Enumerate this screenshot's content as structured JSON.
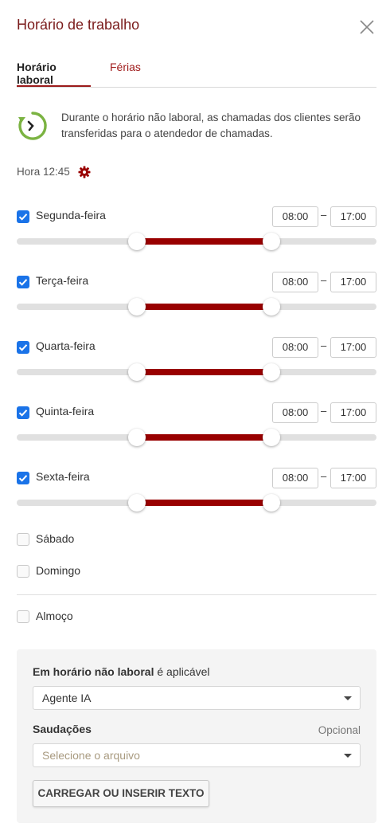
{
  "header": {
    "title": "Horário de trabalho"
  },
  "tabs": [
    {
      "label": "Horário laboral",
      "active": true
    },
    {
      "label": "Férias",
      "active": false
    }
  ],
  "info": {
    "text": "Durante o horário não laboral, as chamadas dos clientes serão transferidas para o atendedor de chamadas."
  },
  "clock": {
    "label": "Hora 12:45"
  },
  "days": [
    {
      "label": "Segunda-feira",
      "checked": true,
      "start": "08:00",
      "end": "17:00"
    },
    {
      "label": "Terça-feira",
      "checked": true,
      "start": "08:00",
      "end": "17:00"
    },
    {
      "label": "Quarta-feira",
      "checked": true,
      "start": "08:00",
      "end": "17:00"
    },
    {
      "label": "Quinta-feira",
      "checked": true,
      "start": "08:00",
      "end": "17:00"
    },
    {
      "label": "Sexta-feira",
      "checked": true,
      "start": "08:00",
      "end": "17:00"
    }
  ],
  "weekend": [
    {
      "label": "Sábado",
      "checked": false
    },
    {
      "label": "Domingo",
      "checked": false
    }
  ],
  "lunch": {
    "label": "Almoço",
    "checked": false
  },
  "panel": {
    "title_bold": "Em horário não laboral",
    "title_rest": " é aplicável",
    "mode_value": "Agente IA",
    "greetings_label": "Saudações",
    "optional_label": "Opcional",
    "file_placeholder": "Selecione o arquivo",
    "upload_button": "CARREGAR OU INSERIR TEXTO"
  },
  "colors": {
    "accent": "#990000",
    "title": "#7a1b1b",
    "checkbox": "#1a73e8"
  },
  "icons": {
    "close": "close-icon",
    "clock": "clock-refresh-icon",
    "gear": "gear-icon",
    "caret": "caret-down-icon",
    "check": "check-icon"
  }
}
